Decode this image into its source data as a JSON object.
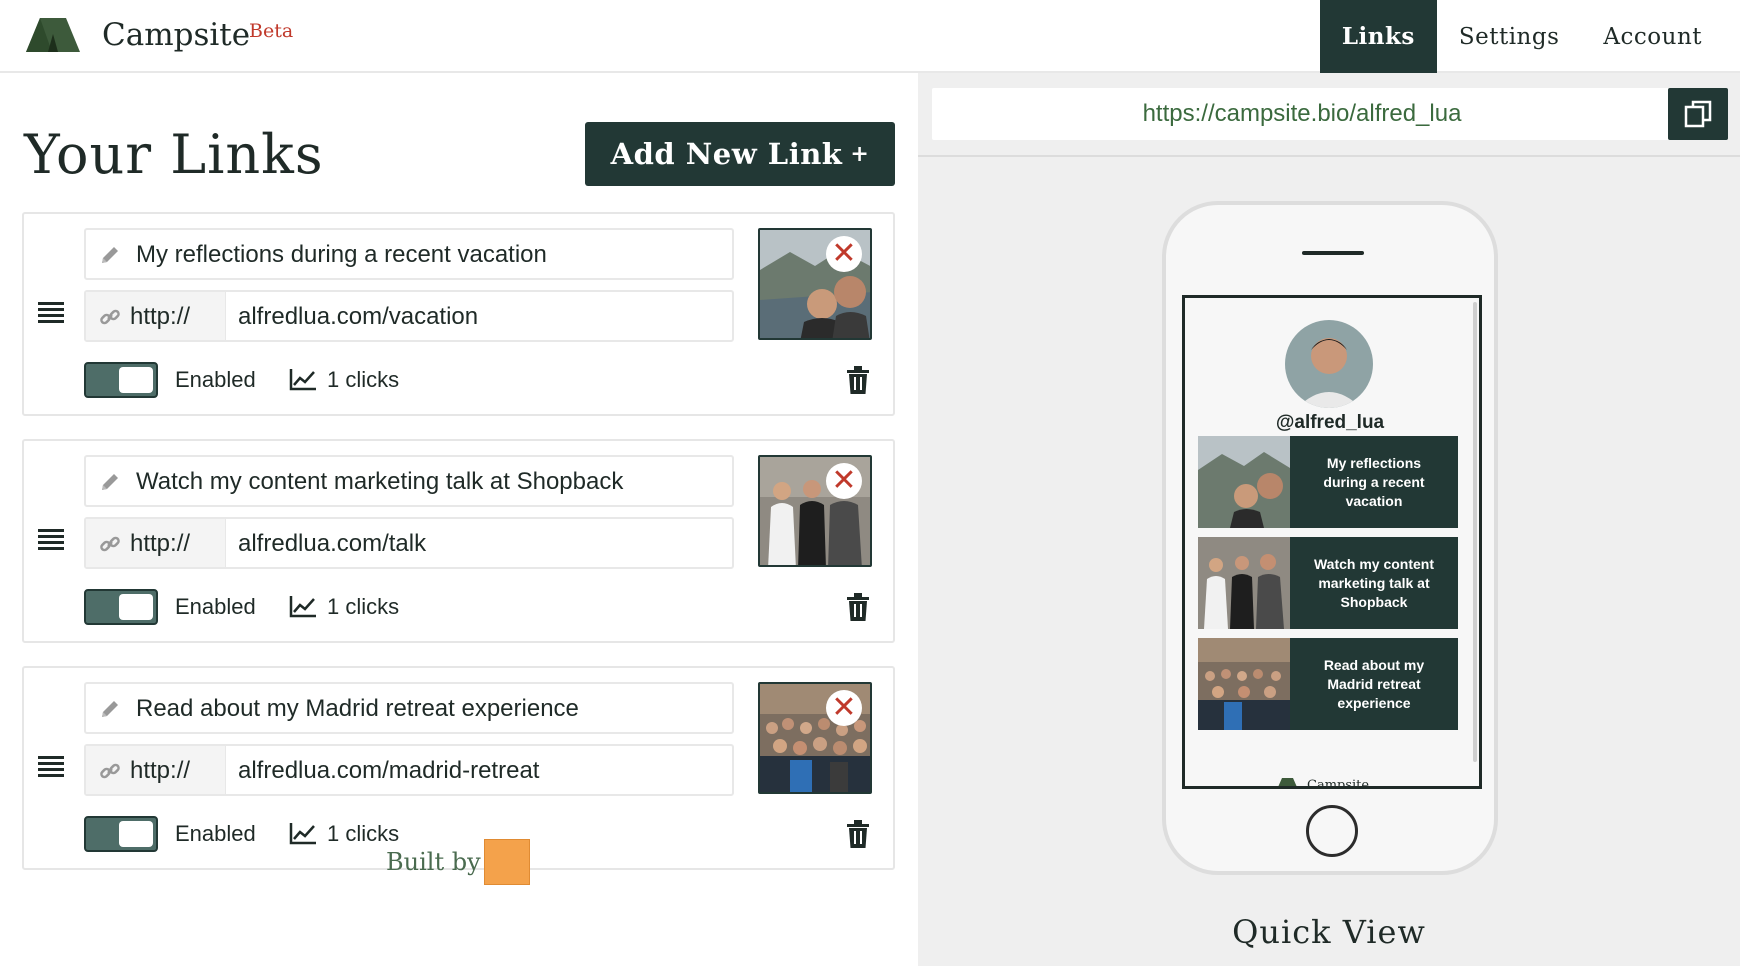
{
  "header": {
    "brand": "Campsite",
    "beta": "Beta",
    "nav": [
      {
        "label": "Links",
        "active": true
      },
      {
        "label": "Settings",
        "active": false
      },
      {
        "label": "Account",
        "active": false
      }
    ]
  },
  "links_panel": {
    "title": "Your Links",
    "add_button": "Add New Link",
    "add_button_symbol": "+",
    "links": [
      {
        "title": "My reflections during a recent vacation",
        "protocol": "http://",
        "url": "alfredlua.com/vacation",
        "status": "Enabled",
        "clicks": "1 clicks"
      },
      {
        "title": "Watch my content marketing talk at Shopback",
        "protocol": "http://",
        "url": "alfredlua.com/talk",
        "status": "Enabled",
        "clicks": "1 clicks"
      },
      {
        "title": "Read about my Madrid retreat experience",
        "protocol": "http://",
        "url": "alfredlua.com/madrid-retreat",
        "status": "Enabled",
        "clicks": "1 clicks"
      }
    ],
    "remove_symbol": "✕",
    "built_by": "Built by"
  },
  "preview": {
    "url": "https://campsite.bio/alfred_lua",
    "handle": "@alfred_lua",
    "links": [
      "My reflections during a recent vacation",
      "Watch my content marketing talk at Shopback",
      "Read about my Madrid retreat experience"
    ],
    "footer": "Campsite",
    "quick_view": "Quick View"
  },
  "colors": {
    "primary": "#223835",
    "toggle": "#4e6d68",
    "accent_red": "#c0392b",
    "url_green": "#3b6a3e",
    "built_by_logo": "#f4a24b"
  },
  "icons": [
    "tent-logo-icon",
    "pencil-icon",
    "link-icon",
    "drag-handle-icon",
    "chart-icon",
    "trash-icon",
    "close-icon",
    "copy-icon",
    "home-button-icon"
  ]
}
